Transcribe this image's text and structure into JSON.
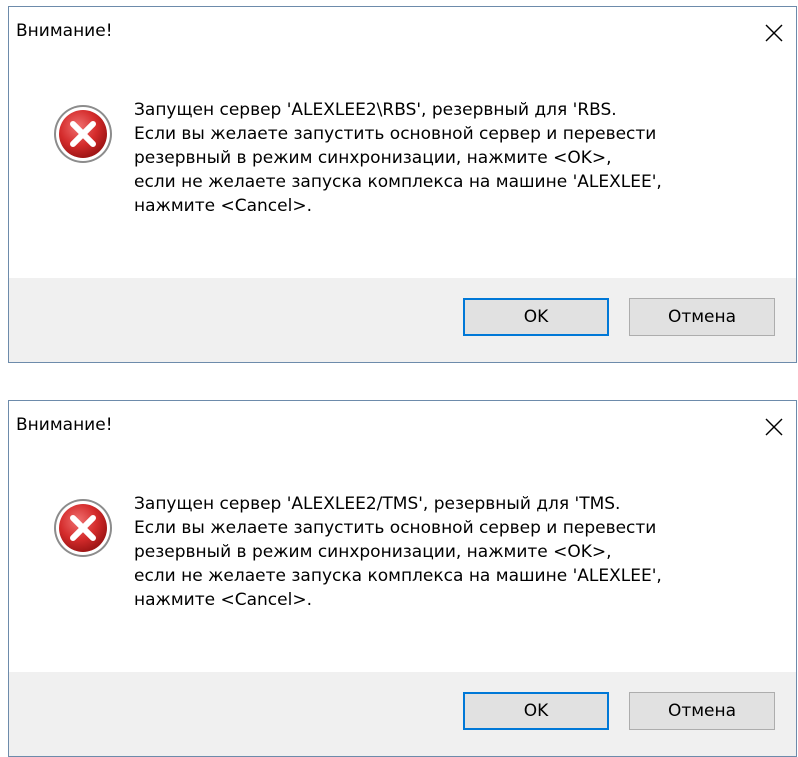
{
  "dialogs": [
    {
      "title": "Внимание!",
      "message_lines": [
        "Запущен сервер 'ALEXLEE2\\RBS', резервный для 'RBS.",
        "Если вы желаете запустить основной сервер и перевести",
        "резервный в режим синхронизации, нажмите <OK>,",
        "если не желаете запуска комплекса на машине 'ALEXLEE',",
        "нажмите <Cancel>."
      ],
      "ok_label": "OK",
      "cancel_label": "Отмена",
      "icon": "error-icon"
    },
    {
      "title": "Внимание!",
      "message_lines": [
        "Запущен сервер 'ALEXLEE2/TMS', резервный для 'TMS.",
        "Если вы желаете запустить основной сервер и перевести",
        "резервный в режим синхронизации, нажмите <OK>,",
        "если не желаете запуска комплекса на машине 'ALEXLEE',",
        "нажмите <Cancel>."
      ],
      "ok_label": "OK",
      "cancel_label": "Отмена",
      "icon": "error-icon"
    }
  ],
  "colors": {
    "accent": "#0078d7",
    "error_red": "#d42b2b",
    "footer_bg": "#f0f0f0"
  }
}
